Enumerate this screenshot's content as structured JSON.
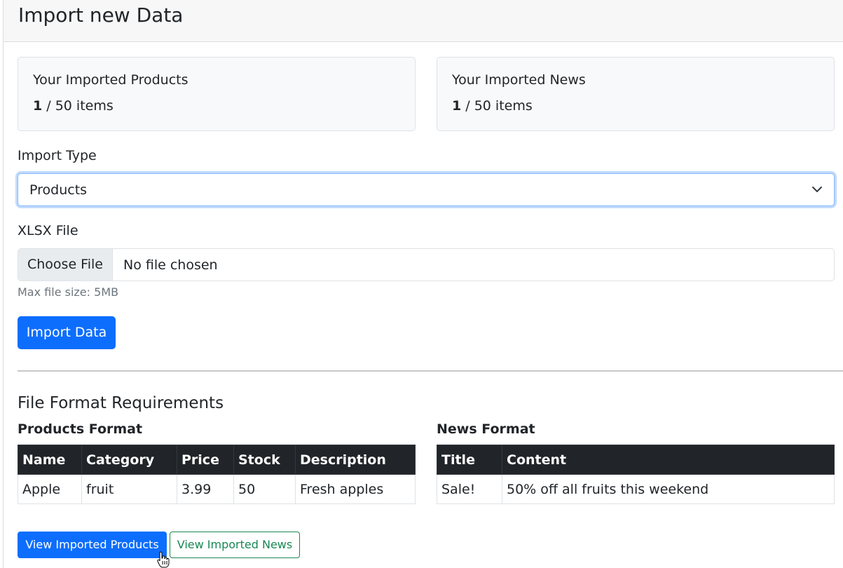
{
  "header": {
    "title": "Import new Data"
  },
  "stats": {
    "products": {
      "title": "Your Imported Products",
      "count": "1",
      "suffix": " / 50 items"
    },
    "news": {
      "title": "Your Imported News",
      "count": "1",
      "suffix": " / 50 items"
    }
  },
  "form": {
    "import_type_label": "Import Type",
    "import_type_value": "Products",
    "file_label": "XLSX File",
    "choose_file": "Choose File",
    "file_status": "No file chosen",
    "hint": "Max file size: 5MB",
    "submit": "Import Data"
  },
  "requirements": {
    "title": "File Format Requirements",
    "products": {
      "title": "Products Format",
      "headers": [
        "Name",
        "Category",
        "Price",
        "Stock",
        "Description"
      ],
      "rows": [
        [
          "Apple",
          "fruit",
          "3.99",
          "50",
          "Fresh apples"
        ]
      ]
    },
    "news": {
      "title": "News Format",
      "headers": [
        "Title",
        "Content"
      ],
      "rows": [
        [
          "Sale!",
          "50% off all fruits this weekend"
        ]
      ]
    }
  },
  "actions": {
    "view_products": "View Imported Products",
    "view_news": "View Imported News"
  },
  "colors": {
    "primary": "#0d6efd",
    "success": "#198754",
    "dark": "#212529"
  }
}
